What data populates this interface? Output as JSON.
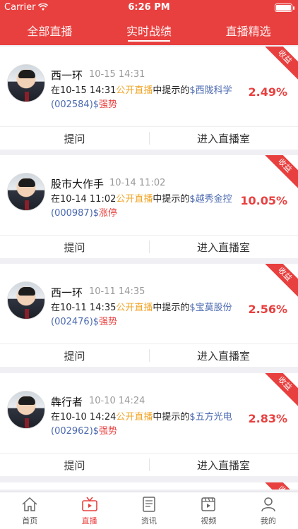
{
  "status": {
    "carrier": "Carrier",
    "time": "6:26 PM"
  },
  "tabs": [
    {
      "label": "全部直播"
    },
    {
      "label": "实时战绩"
    },
    {
      "label": "直播精选"
    }
  ],
  "cards": [
    {
      "name": "西一环",
      "time": "10-15 14:31",
      "pre": "在10-15 14:31",
      "public": "公开直播",
      "mid": "中提示的",
      "stock": "$西陇科学(002584)$",
      "status": "强势",
      "percent": "2.49%",
      "ribbon": "收益",
      "ask": "提问",
      "enter": "进入直播室"
    },
    {
      "name": "股市大作手",
      "time": "10-14 11:02",
      "pre": "在10-14 11:02",
      "public": "公开直播",
      "mid": "中提示的",
      "stock": "$越秀金控(000987)$",
      "status": "涨停",
      "percent": "10.05%",
      "ribbon": "收益",
      "ask": "提问",
      "enter": "进入直播室"
    },
    {
      "name": "西一环",
      "time": "10-11 14:35",
      "pre": "在10-11 14:35",
      "public": "公开直播",
      "mid": "中提示的",
      "stock": "$宝莫股份(002476)$",
      "status": "强势",
      "percent": "2.56%",
      "ribbon": "收益",
      "ask": "提问",
      "enter": "进入直播室"
    },
    {
      "name": "犇行者",
      "time": "10-10 14:24",
      "pre": "在10-10 14:24",
      "public": "公开直播",
      "mid": "中提示的",
      "stock": "$五方光电(002962)$",
      "status": "强势",
      "percent": "2.83%",
      "ribbon": "收益",
      "ask": "提问",
      "enter": "进入直播室"
    }
  ],
  "bottom_tabs": [
    {
      "label": "首页",
      "icon": "home-icon"
    },
    {
      "label": "直播",
      "icon": "tv-icon"
    },
    {
      "label": "资讯",
      "icon": "news-icon"
    },
    {
      "label": "视频",
      "icon": "video-icon"
    },
    {
      "label": "我的",
      "icon": "user-icon"
    }
  ],
  "colors": {
    "brand": "#e8403f",
    "public": "#f0a72c",
    "stock": "#4a69b0"
  }
}
